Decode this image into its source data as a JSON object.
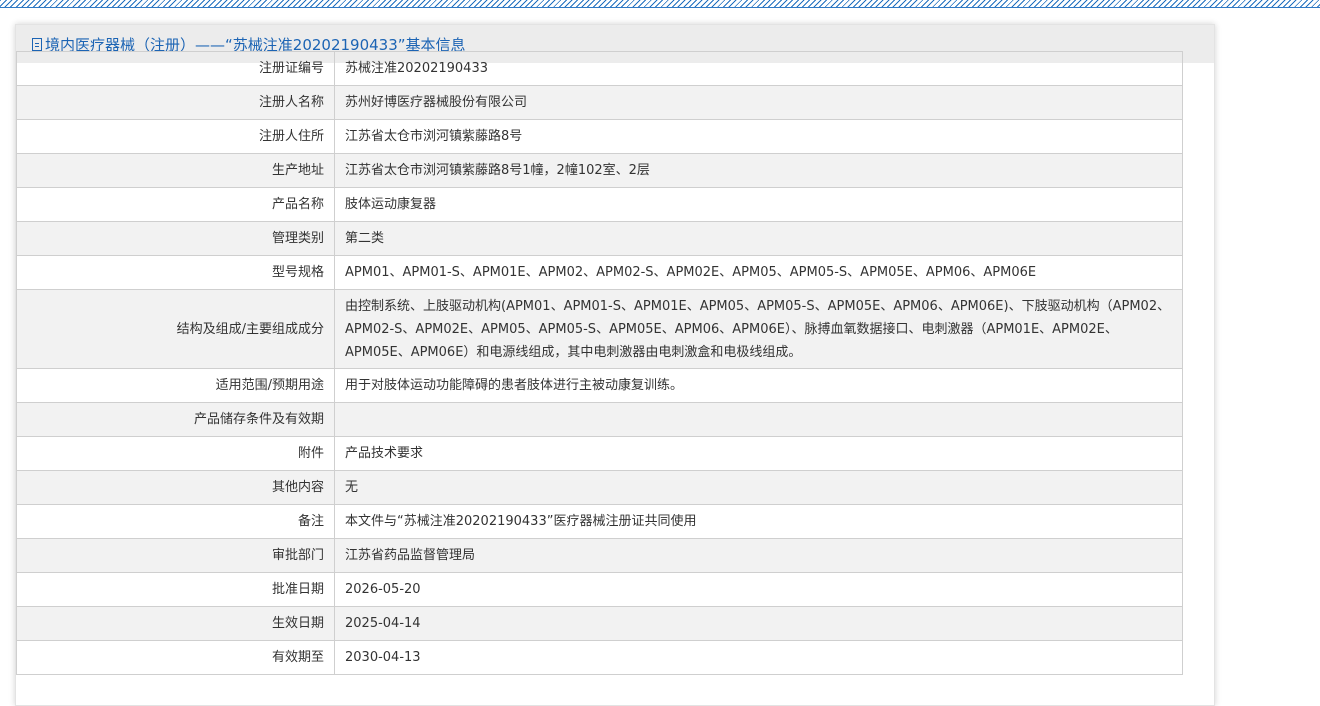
{
  "header": {
    "title": "境内医疗器械（注册）——“苏械注准20202190433”基本信息",
    "icon": "document-icon"
  },
  "rows": [
    {
      "label": "注册证编号",
      "value": "苏械注准20202190433"
    },
    {
      "label": "注册人名称",
      "value": "苏州好博医疗器械股份有限公司"
    },
    {
      "label": "注册人住所",
      "value": "江苏省太仓市浏河镇紫藤路8号"
    },
    {
      "label": "生产地址",
      "value": "江苏省太仓市浏河镇紫藤路8号1幢，2幢102室、2层"
    },
    {
      "label": "产品名称",
      "value": "肢体运动康复器"
    },
    {
      "label": "管理类别",
      "value": "第二类"
    },
    {
      "label": "型号规格",
      "value": "APM01、APM01-S、APM01E、APM02、APM02-S、APM02E、APM05、APM05-S、APM05E、APM06、APM06E"
    },
    {
      "label": "结构及组成/主要组成成分",
      "value": "由控制系统、上肢驱动机构(APM01、APM01-S、APM01E、APM05、APM05-S、APM05E、APM06、APM06E)、下肢驱动机构（APM02、APM02-S、APM02E、APM05、APM05-S、APM05E、APM06、APM06E）、脉搏血氧数据接口、电刺激器（APM01E、APM02E、APM05E、APM06E）和电源线组成，其中电刺激器由电刺激盒和电极线组成。"
    },
    {
      "label": "适用范围/预期用途",
      "value": "用于对肢体运动功能障碍的患者肢体进行主被动康复训练。"
    },
    {
      "label": "产品储存条件及有效期",
      "value": ""
    },
    {
      "label": "附件",
      "value": "产品技术要求"
    },
    {
      "label": "其他内容",
      "value": "无"
    },
    {
      "label": "备注",
      "value": "本文件与“苏械注准20202190433”医疗器械注册证共同使用"
    },
    {
      "label": "审批部门",
      "value": "江苏省药品监督管理局"
    },
    {
      "label": "批准日期",
      "value": "2026-05-20"
    },
    {
      "label": "生效日期",
      "value": "2025-04-14"
    },
    {
      "label": "有效期至",
      "value": "2030-04-13"
    }
  ]
}
